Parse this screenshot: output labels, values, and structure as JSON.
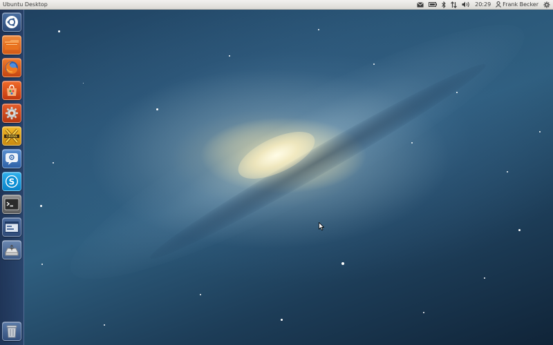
{
  "top_panel": {
    "title": "Ubuntu Desktop",
    "clock": "20:29",
    "user_name": "Frank Becker",
    "indicators": [
      "mail-icon",
      "battery-icon",
      "bluetooth-icon",
      "network-icon",
      "volume-icon",
      "user-icon",
      "session-gear-icon"
    ]
  },
  "launcher": {
    "items": [
      {
        "name": "dash-home",
        "icon": "ubuntu-logo-icon"
      },
      {
        "name": "files",
        "icon": "folder-icon"
      },
      {
        "name": "firefox",
        "icon": "firefox-icon"
      },
      {
        "name": "software-center",
        "icon": "shopping-bag-icon"
      },
      {
        "name": "system-settings",
        "icon": "settings-gears-icon"
      },
      {
        "name": "crossover",
        "icon": "crossover-icon"
      },
      {
        "name": "empathy",
        "icon": "chat-bubble-icon"
      },
      {
        "name": "skype",
        "icon": "skype-icon"
      },
      {
        "name": "terminal",
        "icon": "terminal-icon"
      },
      {
        "name": "workspace-switcher",
        "icon": "workspace-icon"
      },
      {
        "name": "usb-drive",
        "icon": "usb-drive-icon"
      },
      {
        "name": "trash",
        "icon": "trash-icon"
      }
    ]
  },
  "colors": {
    "launcher_bg": "#1e3255",
    "panel_bg": "#e8e6e2",
    "accent_orange": "#e9571c"
  }
}
